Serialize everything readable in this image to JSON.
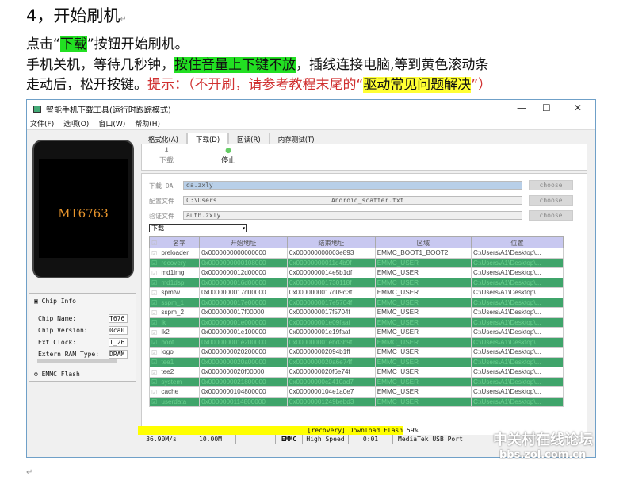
{
  "doc": {
    "heading": "4，开始刷机",
    "l1a": "点击“",
    "l1b": "下载",
    "l1c": "”按钮开始刷机。",
    "l2a": "手机关机，等待几秒钟，",
    "l2b": "按住音量上下键不放",
    "l2c": "，插线连接电脑,等到黄色滚动条",
    "l3a": "走动后，松开按键。",
    "l3b": "提示：（不开刷，请参考教程末尾的“",
    "l3c": "驱动常见问题解决",
    "l3d": "”）",
    "mark": "↵"
  },
  "window": {
    "title": "智能手机下载工具(运行时跟踪模式)",
    "menu": [
      "文件(F)",
      "选项(O)",
      "窗口(W)",
      "帮助(H)"
    ],
    "min": "—",
    "max": "☐",
    "close": "✕"
  },
  "phone": {
    "model": "MT6763"
  },
  "chip": {
    "title": "Chip Info",
    "fields": [
      {
        "k": "Chip Name:",
        "v": "T676"
      },
      {
        "k": "Chip Version:",
        "v": "0ca0"
      },
      {
        "k": "Ext Clock:",
        "v": "T_26"
      },
      {
        "k": "Extern RAM Type:",
        "v": "DRAM"
      }
    ],
    "storage": "EMMC Flash"
  },
  "tabs": [
    "格式化(A)",
    "下载(D)",
    "回读(R)",
    "内存测试(T)"
  ],
  "toolbar": {
    "download": "下载",
    "stop": "停止"
  },
  "form": {
    "da_label": "下载 DA",
    "da": "da.zxly",
    "cfg_label": "配置文件",
    "cfg": "C:\\Users                              Android_scatter.txt",
    "auth_label": "验证文件",
    "auth": "auth.zxly",
    "choose": "choose",
    "mode": "下载"
  },
  "table": {
    "headers": [
      "名字",
      "开始地址",
      "结束地址",
      "区域",
      "位置"
    ],
    "rows": [
      [
        "preloader",
        "0x0000000000000000",
        "0x000000000003e893",
        "EMMC_BOOT1_BOOT2",
        "C:\\Users\\A1\\Desktop\\..."
      ],
      [
        "recovery",
        "0x0000000000108000",
        "0x00000000011d4b9f",
        "EMMC_USER",
        "C:\\Users\\A1\\Desktop\\..."
      ],
      [
        "md1img",
        "0x0000000012d00000",
        "0x0000000014e5b1df",
        "EMMC_USER",
        "C:\\Users\\A1\\Desktop\\..."
      ],
      [
        "md1dsp",
        "0x0000000016d00000",
        "0x000000001730118f",
        "EMMC_USER",
        "C:\\Users\\A1\\Desktop\\..."
      ],
      [
        "spmfw",
        "0x0000000017d00000",
        "0x0000000017d09d3f",
        "EMMC_USER",
        "C:\\Users\\A1\\Desktop\\..."
      ],
      [
        "sspm_1",
        "0x0000000017e00000",
        "0x0000000017e5704f",
        "EMMC_USER",
        "C:\\Users\\A1\\Desktop\\..."
      ],
      [
        "sspm_2",
        "0x0000000017f00000",
        "0x0000000017f5704f",
        "EMMC_USER",
        "C:\\Users\\A1\\Desktop\\..."
      ],
      [
        "lk",
        "0x000000001e000000",
        "0x000000001e09faaf",
        "EMMC_USER",
        "C:\\Users\\A1\\Desktop\\..."
      ],
      [
        "lk2",
        "0x000000001e100000",
        "0x000000001e19faaf",
        "EMMC_USER",
        "C:\\Users\\A1\\Desktop\\..."
      ],
      [
        "boot",
        "0x000000001e200000",
        "0x000000001ebd3b9f",
        "EMMC_USER",
        "C:\\Users\\A1\\Desktop\\..."
      ],
      [
        "logo",
        "0x0000000020200000",
        "0x000000002094b1ff",
        "EMMC_USER",
        "C:\\Users\\A1\\Desktop\\..."
      ],
      [
        "tee1",
        "0x0000000020a00000",
        "0x0000000020a6e74f",
        "EMMC_USER",
        "C:\\Users\\A1\\Desktop\\..."
      ],
      [
        "tee2",
        "0x0000000020f00000",
        "0x0000000020f6e74f",
        "EMMC_USER",
        "C:\\Users\\A1\\Desktop\\..."
      ],
      [
        "system",
        "0x0000000021800000",
        "0x00000000c2410ad7",
        "EMMC_USER",
        "C:\\Users\\A1\\Desktop\\..."
      ],
      [
        "cache",
        "0x0000000104800000",
        "0x0000000104e1a0e7",
        "EMMC_USER",
        "C:\\Users\\A1\\Desktop\\..."
      ],
      [
        "userdata",
        "0x0000000114800000",
        "0x00000001249bebd3",
        "EMMC_USER",
        "C:\\Users\\A1\\Desktop\\..."
      ]
    ]
  },
  "progress": {
    "text": "[recovery] Download Flash 59%",
    "percent": 59,
    "color": "#ffff00"
  },
  "status": {
    "speed": "36.90M/s",
    "size": "10.00M",
    "storage": "EMMC",
    "mode": "High Speed",
    "time": "0:01",
    "port": "MediaTek USB Port"
  },
  "watermark": {
    "name": "中关村在线论坛",
    "url": "bbs.zol.com.cn"
  }
}
